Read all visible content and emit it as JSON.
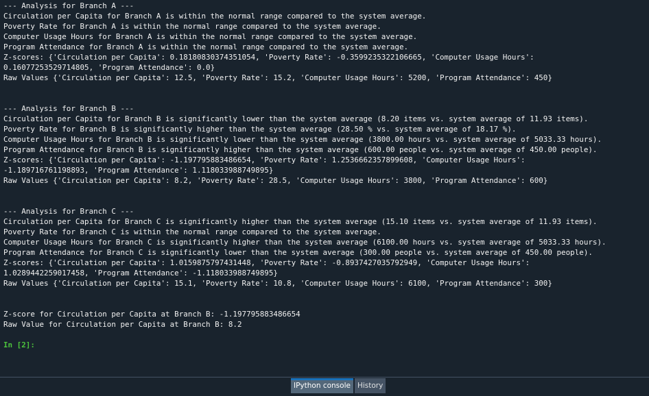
{
  "console": {
    "lines": [
      "--- Analysis for Branch A ---",
      "Circulation per Capita for Branch A is within the normal range compared to the system average.",
      "Poverty Rate for Branch A is within the normal range compared to the system average.",
      "Computer Usage Hours for Branch A is within the normal range compared to the system average.",
      "Program Attendance for Branch A is within the normal range compared to the system average.",
      "Z-scores: {'Circulation per Capita': 0.18180830374351054, 'Poverty Rate': -0.3599235322106665, 'Computer Usage Hours':",
      "0.16077253529714805, 'Program Attendance': 0.0}",
      "Raw Values {'Circulation per Capita': 12.5, 'Poverty Rate': 15.2, 'Computer Usage Hours': 5200, 'Program Attendance': 450}",
      "",
      "",
      "--- Analysis for Branch B ---",
      "Circulation per Capita for Branch B is significantly lower than the system average (8.20 items vs. system average of 11.93 items).",
      "Poverty Rate for Branch B is significantly higher than the system average (28.50 % vs. system average of 18.17 %).",
      "Computer Usage Hours for Branch B is significantly lower than the system average (3800.00 hours vs. system average of 5033.33 hours).",
      "Program Attendance for Branch B is significantly higher than the system average (600.00 people vs. system average of 450.00 people).",
      "Z-scores: {'Circulation per Capita': -1.197795883486654, 'Poverty Rate': 1.2536662357899608, 'Computer Usage Hours':",
      "-1.189716761198893, 'Program Attendance': 1.118033988749895}",
      "Raw Values {'Circulation per Capita': 8.2, 'Poverty Rate': 28.5, 'Computer Usage Hours': 3800, 'Program Attendance': 600}",
      "",
      "",
      "--- Analysis for Branch C ---",
      "Circulation per Capita for Branch C is significantly higher than the system average (15.10 items vs. system average of 11.93 items).",
      "Poverty Rate for Branch C is within the normal range compared to the system average.",
      "Computer Usage Hours for Branch C is significantly higher than the system average (6100.00 hours vs. system average of 5033.33 hours).",
      "Program Attendance for Branch C is significantly lower than the system average (300.00 people vs. system average of 450.00 people).",
      "Z-scores: {'Circulation per Capita': 1.0159875797431448, 'Poverty Rate': -0.8937427035792949, 'Computer Usage Hours':",
      "1.0289442259017458, 'Program Attendance': -1.118033988749895}",
      "Raw Values {'Circulation per Capita': 15.1, 'Poverty Rate': 10.8, 'Computer Usage Hours': 6100, 'Program Attendance': 300}",
      "",
      "",
      "Z-score for Circulation per Capita at Branch B: -1.197795883486654",
      "Raw Value for Circulation per Capita at Branch B: 8.2",
      "",
      "In [2]:"
    ]
  },
  "tabs": [
    {
      "label": "IPython console",
      "active": true
    },
    {
      "label": "History",
      "active": false
    }
  ],
  "colors": {
    "background": "#19232d",
    "text": "#f0f0f0",
    "prompt": "#4cc33c",
    "tab_active_border": "#1a72bb"
  }
}
